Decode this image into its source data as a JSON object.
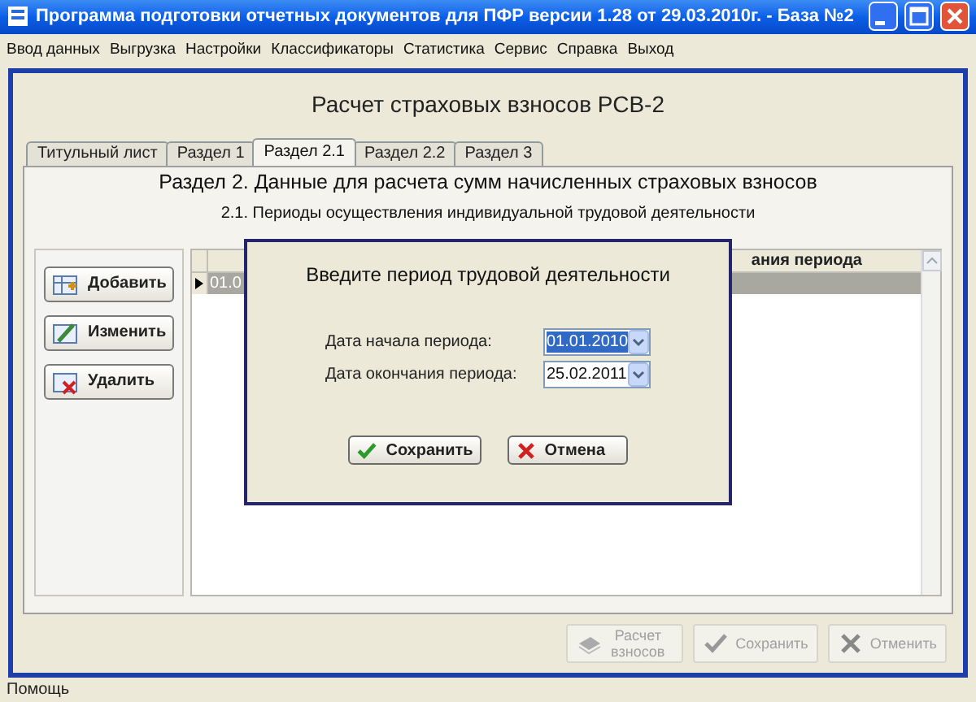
{
  "window": {
    "title": "Программа подготовки отчетных документов для ПФР версии 1.28 от 29.03.2010г. - База №2"
  },
  "menu": {
    "items": [
      "Ввод данных",
      "Выгрузка",
      "Настройки",
      "Классификаторы",
      "Статистика",
      "Сервис",
      "Справка",
      "Выход"
    ]
  },
  "form": {
    "heading": "Расчет страховых взносов РСВ-2",
    "tabs": [
      {
        "label": "Титульный лист",
        "selected": false
      },
      {
        "label": "Раздел 1",
        "selected": false
      },
      {
        "label": "Раздел 2.1",
        "selected": true
      },
      {
        "label": "Раздел 2.2",
        "selected": false
      },
      {
        "label": "Раздел 3",
        "selected": false
      }
    ],
    "section_title": "Раздел 2. Данные для расчета сумм начисленных страховых взносов",
    "subsection_title": "2.1. Периоды осуществления индивидуальной трудовой деятельности",
    "side_buttons": [
      {
        "label": "Добавить",
        "kind": "add"
      },
      {
        "label": "Изменить",
        "kind": "edit"
      },
      {
        "label": "Удалить",
        "kind": "delete"
      }
    ],
    "grid": {
      "column_header": "ания периода",
      "rows": [
        {
          "cell": "01.0",
          "selected": true
        }
      ]
    },
    "bottom_buttons": [
      {
        "label": "Расчет взносов",
        "kind": "calc",
        "disabled": true
      },
      {
        "label": "Сохранить",
        "kind": "save",
        "disabled": true
      },
      {
        "label": "Отменить",
        "kind": "cancel",
        "disabled": true
      }
    ]
  },
  "dialog": {
    "title": "Введите период трудовой деятельности",
    "fields": [
      {
        "label": "Дата начала периода:",
        "value": "01.01.2010",
        "selected": true
      },
      {
        "label": "Дата окончания периода:",
        "value": "25.02.2011",
        "selected": false
      }
    ],
    "buttons": [
      {
        "label": "Сохранить",
        "kind": "save"
      },
      {
        "label": "Отмена",
        "kind": "cancel"
      }
    ]
  },
  "status_bar": {
    "text": "Помощь"
  }
}
